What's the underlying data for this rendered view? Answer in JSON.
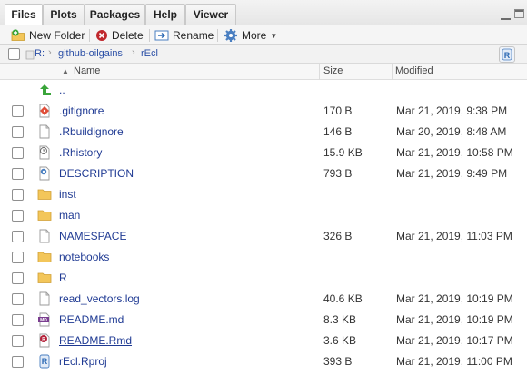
{
  "tabs": [
    {
      "label": "Files",
      "active": true
    },
    {
      "label": "Plots",
      "active": false
    },
    {
      "label": "Packages",
      "active": false
    },
    {
      "label": "Help",
      "active": false
    },
    {
      "label": "Viewer",
      "active": false
    }
  ],
  "toolbar": {
    "new_folder": "New Folder",
    "delete": "Delete",
    "rename": "Rename",
    "more": "More"
  },
  "breadcrumb": [
    "R:",
    "github-oilgains",
    "rEcl"
  ],
  "columns": {
    "name": "Name",
    "size": "Size",
    "modified": "Modified",
    "sort_indicator": "▲"
  },
  "files": [
    {
      "name": "..",
      "icon": "up-arrow-icon",
      "size": "",
      "modified": "",
      "checkbox": false
    },
    {
      "name": ".gitignore",
      "icon": "git-file-icon",
      "size": "170 B",
      "modified": "Mar 21, 2019, 9:38 PM",
      "checkbox": true
    },
    {
      "name": ".Rbuildignore",
      "icon": "text-file-icon",
      "size": "146 B",
      "modified": "Mar 20, 2019, 8:48 AM",
      "checkbox": true
    },
    {
      "name": ".Rhistory",
      "icon": "history-file-icon",
      "size": "15.9 KB",
      "modified": "Mar 21, 2019, 10:58 PM",
      "checkbox": true
    },
    {
      "name": "DESCRIPTION",
      "icon": "description-gear-icon",
      "size": "793 B",
      "modified": "Mar 21, 2019, 9:49 PM",
      "checkbox": true
    },
    {
      "name": "inst",
      "icon": "folder-icon",
      "size": "",
      "modified": "",
      "checkbox": true
    },
    {
      "name": "man",
      "icon": "folder-icon",
      "size": "",
      "modified": "",
      "checkbox": true
    },
    {
      "name": "NAMESPACE",
      "icon": "text-file-icon",
      "size": "326 B",
      "modified": "Mar 21, 2019, 11:03 PM",
      "checkbox": true
    },
    {
      "name": "notebooks",
      "icon": "folder-icon",
      "size": "",
      "modified": "",
      "checkbox": true
    },
    {
      "name": "R",
      "icon": "folder-icon",
      "size": "",
      "modified": "",
      "checkbox": true
    },
    {
      "name": "read_vectors.log",
      "icon": "text-file-icon",
      "size": "40.6 KB",
      "modified": "Mar 21, 2019, 10:19 PM",
      "checkbox": true
    },
    {
      "name": "README.md",
      "icon": "markdown-file-icon",
      "size": "8.3 KB",
      "modified": "Mar 21, 2019, 10:19 PM",
      "checkbox": true
    },
    {
      "name": "README.Rmd",
      "icon": "rmarkdown-file-icon",
      "size": "3.6 KB",
      "modified": "Mar 21, 2019, 10:17 PM",
      "checkbox": true,
      "underline": true
    },
    {
      "name": "rEcl.Rproj",
      "icon": "rproj-file-icon",
      "size": "393 B",
      "modified": "Mar 21, 2019, 11:00 PM",
      "checkbox": true
    }
  ],
  "colors": {
    "link": "#1f3a93",
    "folder": "#f3c65a",
    "accent_green": "#3aa53a"
  }
}
